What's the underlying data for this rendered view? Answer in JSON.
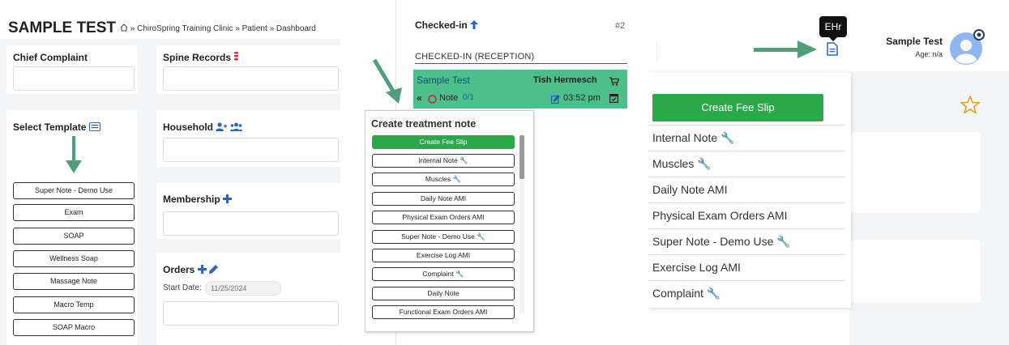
{
  "panel1": {
    "app_title": "SAMPLE TEST",
    "breadcrumb": [
      "ChiroSpring Training Clinic",
      "Patient",
      "Dashboard"
    ],
    "breadcrumb_sep": "»",
    "chief_complaint": "Chief Complaint",
    "spine_records": "Spine Records",
    "select_template": "Select Template",
    "household": "Household",
    "membership": "Membership",
    "orders": "Orders",
    "start_date_label": "Start Date:",
    "start_date_placeholder": "11/25/2024",
    "templates": [
      "Super Note - Demo Use",
      "Exam",
      "SOAP",
      "Wellness Soap",
      "Massage Note",
      "Macro Temp",
      "SOAP Macro"
    ]
  },
  "panel2": {
    "checked_in": "Checked-in",
    "count": "#2",
    "section": "CHECKED-IN (RECEPTION)",
    "patient_name": "Sample Test",
    "provider": "Tish Hermesch",
    "note_label": "Note",
    "note_count": "0/1",
    "time": "03:52 pm",
    "menu_title": "Create treatment note",
    "notes": [
      {
        "label": "Create Fee Slip",
        "key": false
      },
      {
        "label": "Internal Note",
        "key": true
      },
      {
        "label": "Muscles",
        "key": true
      },
      {
        "label": "Daily Note AMI",
        "key": false
      },
      {
        "label": "Physical Exam Orders AMI",
        "key": false
      },
      {
        "label": "Super Note - Demo Use",
        "key": true
      },
      {
        "label": "Exercise Log AMI",
        "key": false
      },
      {
        "label": "Complaint",
        "key": true
      },
      {
        "label": "Daily Note",
        "key": false
      },
      {
        "label": "Functional Exam Orders AMI",
        "key": false
      }
    ]
  },
  "panel3": {
    "tooltip": "EHr",
    "patient_name": "Sample Test",
    "age": "Age: n/a",
    "create_fee_slip": "Create Fee Slip",
    "items": [
      {
        "label": "Internal Note",
        "key": true
      },
      {
        "label": "Muscles",
        "key": true
      },
      {
        "label": "Daily Note AMI",
        "key": false
      },
      {
        "label": "Physical Exam Orders AMI",
        "key": false
      },
      {
        "label": "Super Note - Demo Use",
        "key": true
      },
      {
        "label": "Exercise Log AMI",
        "key": false
      },
      {
        "label": "Complaint",
        "key": true
      }
    ]
  },
  "colors": {
    "primary_green": "#2aa84a",
    "teal_green": "#4cbf8a",
    "arrow": "#4fa07a",
    "key_icon": "#f0b400",
    "avatar": "#8fb6f0"
  }
}
